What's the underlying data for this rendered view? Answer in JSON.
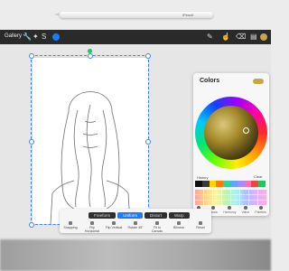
{
  "pencil": {
    "brand": "iPencil"
  },
  "topbar": {
    "gallery_label": "Gallery",
    "tools": [
      "wrench-icon",
      "magic-wand-icon",
      "selection-icon",
      "transform-icon"
    ],
    "right_tools": [
      "brush-icon",
      "smudge-icon",
      "eraser-icon",
      "layers-icon"
    ],
    "current_color": "#1e7cf2"
  },
  "colors_panel": {
    "title": "Colors",
    "current_swatch": "#c7a64a",
    "history_label": "History",
    "clear_label": "Clear",
    "recent_colors": [
      "#111111",
      "#3b3b3b",
      "#ffd400",
      "#ff7a00",
      "#34d399",
      "#60a5fa",
      "#a78bfa",
      "#f472b6",
      "#ef4444",
      "#22c55e"
    ],
    "tabs": [
      "Disc",
      "Classic",
      "Harmony",
      "Value",
      "Palettes"
    ]
  },
  "transform": {
    "modes": [
      {
        "label": "Freeform",
        "active": false
      },
      {
        "label": "Uniform",
        "active": true
      },
      {
        "label": "Distort",
        "active": false
      },
      {
        "label": "Warp",
        "active": false
      }
    ],
    "actions": [
      "Snapping",
      "Flip Horizontal",
      "Flip Vertical",
      "Rotate 45°",
      "Fit to Canvas",
      "Bilinear",
      "Reset"
    ]
  }
}
